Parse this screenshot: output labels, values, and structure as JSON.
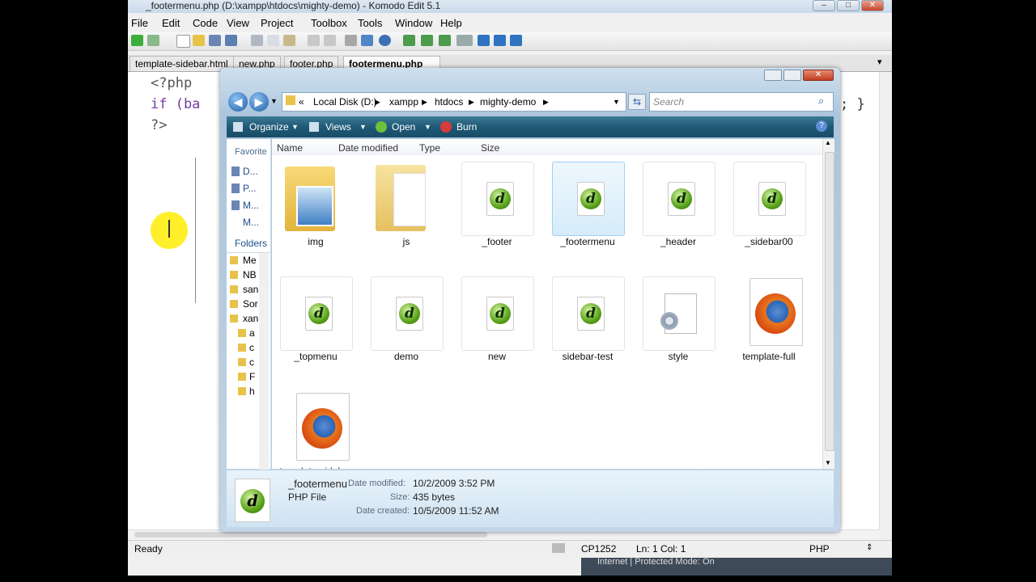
{
  "komodo": {
    "title": "_footermenu.php (D:\\xampp\\htdocs\\mighty-demo) - Komodo Edit 5.1",
    "menu": [
      "File",
      "Edit",
      "Code",
      "View",
      "Project",
      "Toolbox",
      "Tools",
      "Window",
      "Help"
    ],
    "tabs": [
      {
        "label": "template-sidebar.html"
      },
      {
        "label": "new.php"
      },
      {
        "label": "footer.php"
      },
      {
        "label": "footermenu.php"
      }
    ],
    "tab_close": "×",
    "code_lines": [
      "<?php",
      "if  (ba",
      "?>"
    ],
    "code_right": "; }",
    "status": {
      "ready": "Ready",
      "encoding": "CP1252",
      "position": "Ln: 1 Col: 1",
      "language": "PHP"
    }
  },
  "explorer": {
    "breadcrumb": {
      "chevrons": "«",
      "disk": "Local Disk (D:)",
      "p1": "xampp",
      "p2": "htdocs",
      "p3": "mighty-demo"
    },
    "search_placeholder": "Search",
    "toolbar": {
      "organize": "Organize",
      "views": "Views",
      "open": "Open",
      "burn": "Burn"
    },
    "nav": {
      "favorites": "Favorite",
      "links": [
        "D...",
        "P...",
        "M...",
        "M..."
      ],
      "folders": "Folders",
      "tree": [
        "Me",
        "NB",
        "san",
        "Sor",
        "xan",
        "a",
        "c",
        "c",
        "F",
        "h"
      ]
    },
    "columns": [
      "Name",
      "Date modified",
      "Type",
      "Size"
    ],
    "files": [
      {
        "name": "img",
        "kind": "folder-image"
      },
      {
        "name": "js",
        "kind": "folder"
      },
      {
        "name": "_footer",
        "kind": "php"
      },
      {
        "name": "_footermenu",
        "kind": "php",
        "selected": true
      },
      {
        "name": "_header",
        "kind": "php"
      },
      {
        "name": "_sidebar00",
        "kind": "php"
      },
      {
        "name": "_topmenu",
        "kind": "php"
      },
      {
        "name": "demo",
        "kind": "php"
      },
      {
        "name": "new",
        "kind": "php"
      },
      {
        "name": "sidebar-test",
        "kind": "php"
      },
      {
        "name": "style",
        "kind": "css"
      },
      {
        "name": "template-full",
        "kind": "firefox"
      },
      {
        "name": "template-sidebar",
        "kind": "firefox"
      }
    ],
    "details": {
      "name": "_footermenu",
      "type": "PHP File",
      "modified_label": "Date modified:",
      "modified": "10/2/2009 3:52 PM",
      "size_label": "Size:",
      "size": "435 bytes",
      "created_label": "Date created:",
      "created": "10/5/2009 11:52 AM"
    }
  },
  "taskbar_hint": "Internet | Protected Mode: On"
}
